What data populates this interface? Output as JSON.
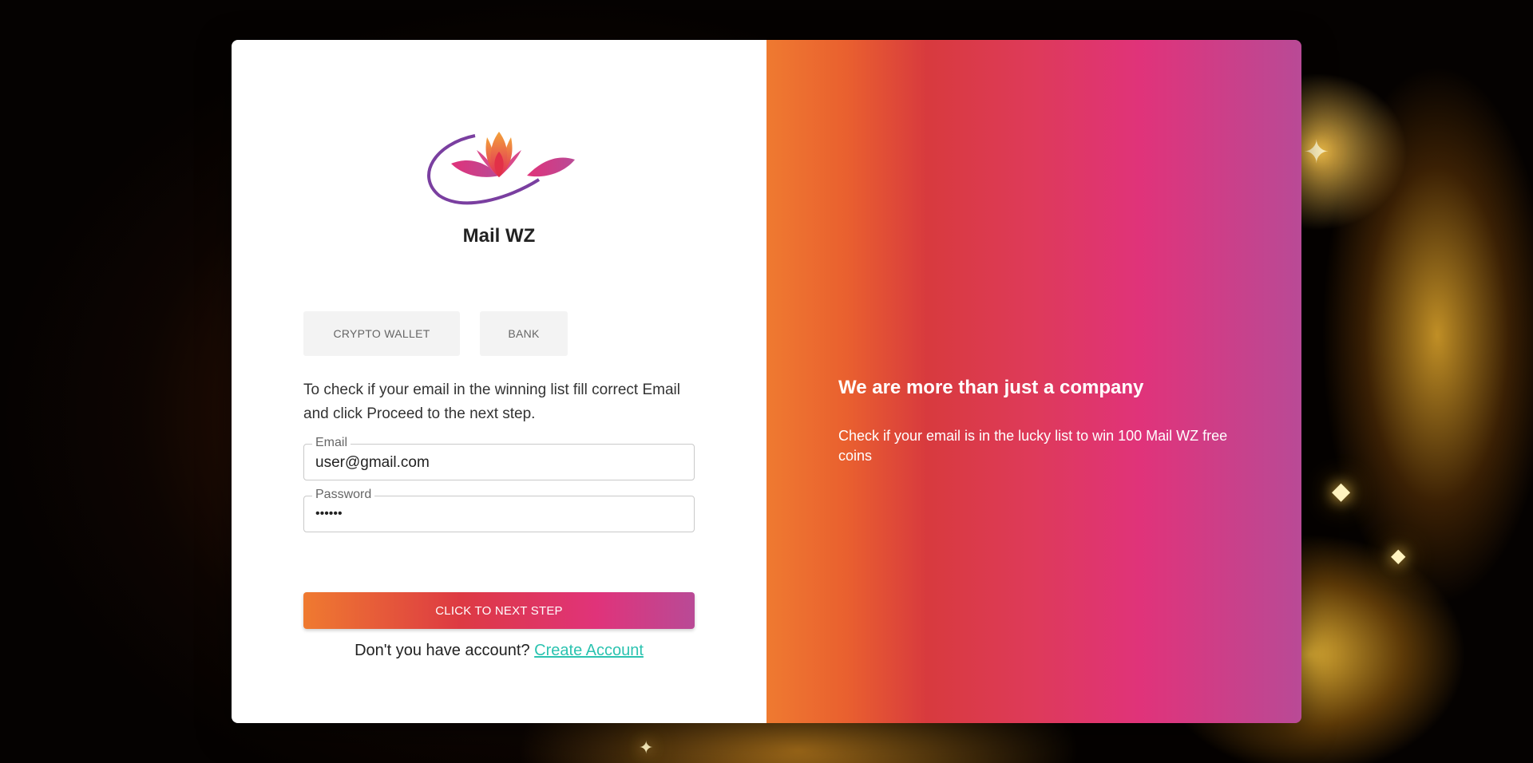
{
  "brand": {
    "name": "Mail WZ",
    "logo_icon": "lotus-logo-icon"
  },
  "tabs": [
    {
      "label": "CRYPTO WALLET"
    },
    {
      "label": "BANK"
    }
  ],
  "form": {
    "intro": "To check if your email in the winning list fill correct Email and click Proceed to the next step.",
    "email": {
      "label": "Email",
      "value": "user@gmail.com"
    },
    "password": {
      "label": "Password",
      "value": "••••••"
    },
    "submit_label": "CLICK TO NEXT STEP",
    "signup_prompt": "Don't you have account?",
    "signup_link": "Create Account"
  },
  "promo": {
    "title": "We are more than just a company",
    "text": "Check if your email is in the lucky list to win 100 Mail WZ free coins"
  },
  "colors": {
    "gradient_start": "#ef7a30",
    "gradient_mid": "#e0337a",
    "gradient_end": "#b94a96",
    "link": "#2cc3b0"
  }
}
